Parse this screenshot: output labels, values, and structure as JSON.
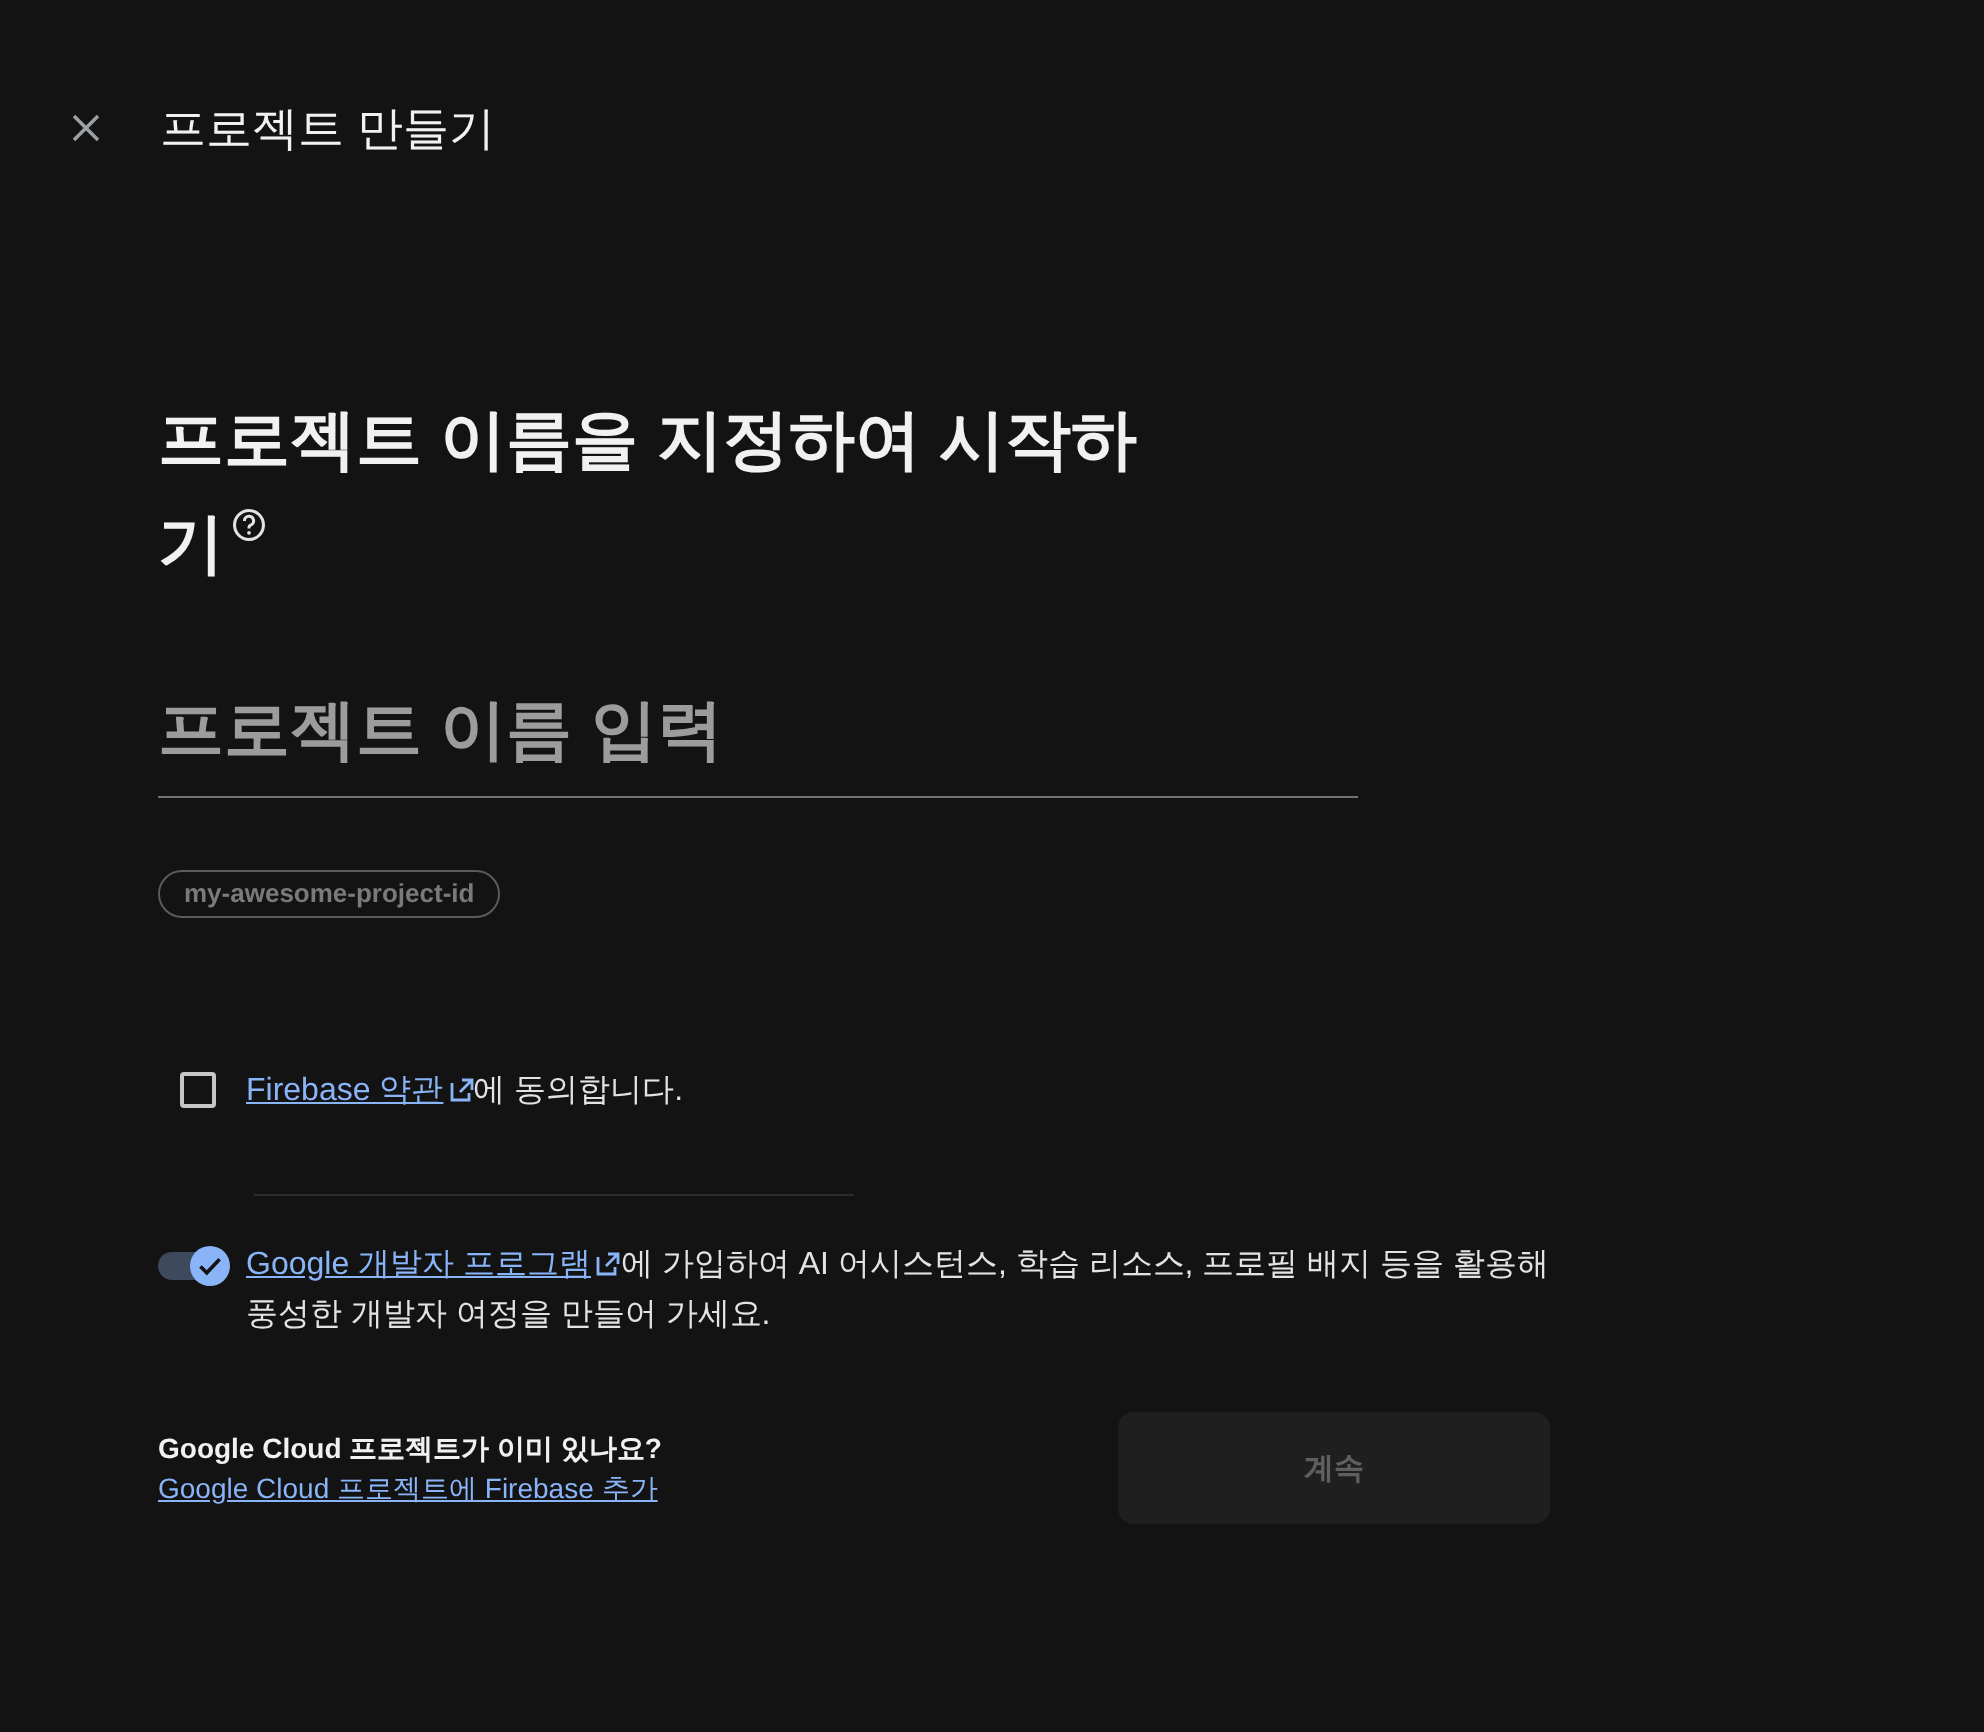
{
  "header": {
    "title": "프로젝트 만들기"
  },
  "heading": {
    "text": "프로젝트 이름을 지정하여 시작하기"
  },
  "project_name": {
    "placeholder": "프로젝트 이름 입력"
  },
  "project_id": {
    "text": "my-awesome-project-id"
  },
  "terms": {
    "checked": false,
    "link": "Firebase 약관",
    "text": "에 동의합니다."
  },
  "dev_program": {
    "on": true,
    "link": "Google 개발자 프로그램",
    "text": "에 가입하여 AI 어시스턴스, 학습 리소스, 프로필 배지 등을 활용해 풍성한 개발자 여정을 만들어 가세요."
  },
  "footer": {
    "question": "Google Cloud 프로젝트가 이미 있나요?",
    "link": "Google Cloud 프로젝트에 Firebase 추가"
  },
  "continue_button": {
    "label": "계속",
    "disabled": true
  }
}
